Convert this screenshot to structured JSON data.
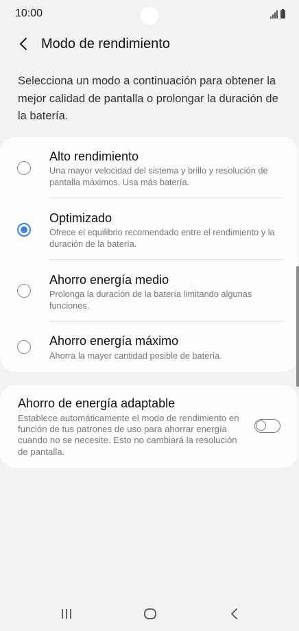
{
  "status_bar": {
    "time": "10:00"
  },
  "header": {
    "title": "Modo de rendimiento"
  },
  "description": "Selecciona un modo a continuación para obtener la mejor calidad de pantalla o prolongar la duración de la batería.",
  "modes": [
    {
      "title": "Alto rendimiento",
      "desc": "Una mayor velocidad del sistema y brillo y resolución de pantalla máximos. Usa más batería.",
      "selected": false
    },
    {
      "title": "Optimizado",
      "desc": "Ofrece el equilibrio recomendado entre el rendimiento y la duración de la batería.",
      "selected": true
    },
    {
      "title": "Ahorro energía medio",
      "desc": "Prolonga la duración de la batería limitando algunas funciones.",
      "selected": false
    },
    {
      "title": "Ahorro energía máximo",
      "desc": "Ahorra la mayor cantidad posible de batería.",
      "selected": false
    }
  ],
  "adaptive": {
    "title": "Ahorro de energía adaptable",
    "desc": "Establece automáticamente el modo de rendimiento en función de tus patrones de uso para ahorrar energía cuando no se necesite. Esto no cambiará la resolución de pantalla.",
    "enabled": false
  },
  "colors": {
    "accent": "#3e82e0",
    "background": "#f2f2f2",
    "card": "#fcfcfc"
  },
  "icons": {
    "back": "chevron-left-icon",
    "recents": "recent-apps-icon",
    "home": "home-icon",
    "nav_back": "back-icon"
  }
}
